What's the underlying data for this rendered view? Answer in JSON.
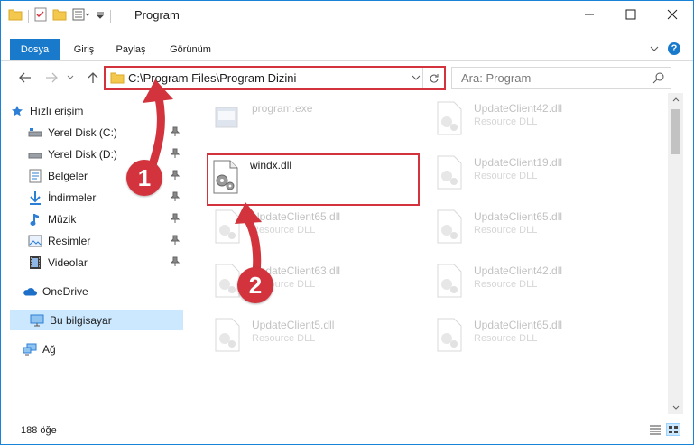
{
  "window": {
    "title": "Program"
  },
  "ribbon": {
    "tabs": [
      "Dosya",
      "Giriş",
      "Paylaş",
      "Görünüm"
    ]
  },
  "navigation": {
    "address": "C:\\Program Files\\Program Dizini",
    "search_placeholder": "Ara: Program"
  },
  "sidebar": {
    "items": [
      {
        "label": "Hızlı erişim",
        "icon": "star-icon"
      },
      {
        "label": "Yerel Disk (C:)",
        "icon": "drive-icon"
      },
      {
        "label": "Yerel Disk (D:)",
        "icon": "drive-icon"
      },
      {
        "label": "Belgeler",
        "icon": "documents-icon"
      },
      {
        "label": "İndirmeler",
        "icon": "download-icon"
      },
      {
        "label": "Müzik",
        "icon": "music-icon"
      },
      {
        "label": "Resimler",
        "icon": "pictures-icon"
      },
      {
        "label": "Videolar",
        "icon": "video-icon"
      },
      {
        "label": "OneDrive",
        "icon": "cloud-icon"
      },
      {
        "label": "Bu bilgisayar",
        "icon": "computer-icon"
      },
      {
        "label": "Ağ",
        "icon": "network-icon"
      }
    ]
  },
  "files": {
    "left": [
      {
        "name": "program.exe",
        "type": ""
      },
      {
        "name": "windx.dll",
        "type": ""
      },
      {
        "name": "UpdateClient65.dll",
        "type": "Resource DLL"
      },
      {
        "name": "UpdateClient63.dll",
        "type": "Resource DLL"
      },
      {
        "name": "UpdateClient5.dll",
        "type": "Resource DLL"
      }
    ],
    "right": [
      {
        "name": "UpdateClient42.dll",
        "type": "Resource DLL"
      },
      {
        "name": "UpdateClient19.dll",
        "type": "Resource DLL"
      },
      {
        "name": "UpdateClient65.dll",
        "type": "Resource DLL"
      },
      {
        "name": "UpdateClient42.dll",
        "type": "Resource DLL"
      },
      {
        "name": "UpdateClient65.dll",
        "type": "Resource DLL"
      }
    ]
  },
  "status": {
    "item_count": "188 öğe"
  },
  "annotations": {
    "callout1": "1",
    "callout2": "2",
    "highlight_color": "#d3333c"
  }
}
